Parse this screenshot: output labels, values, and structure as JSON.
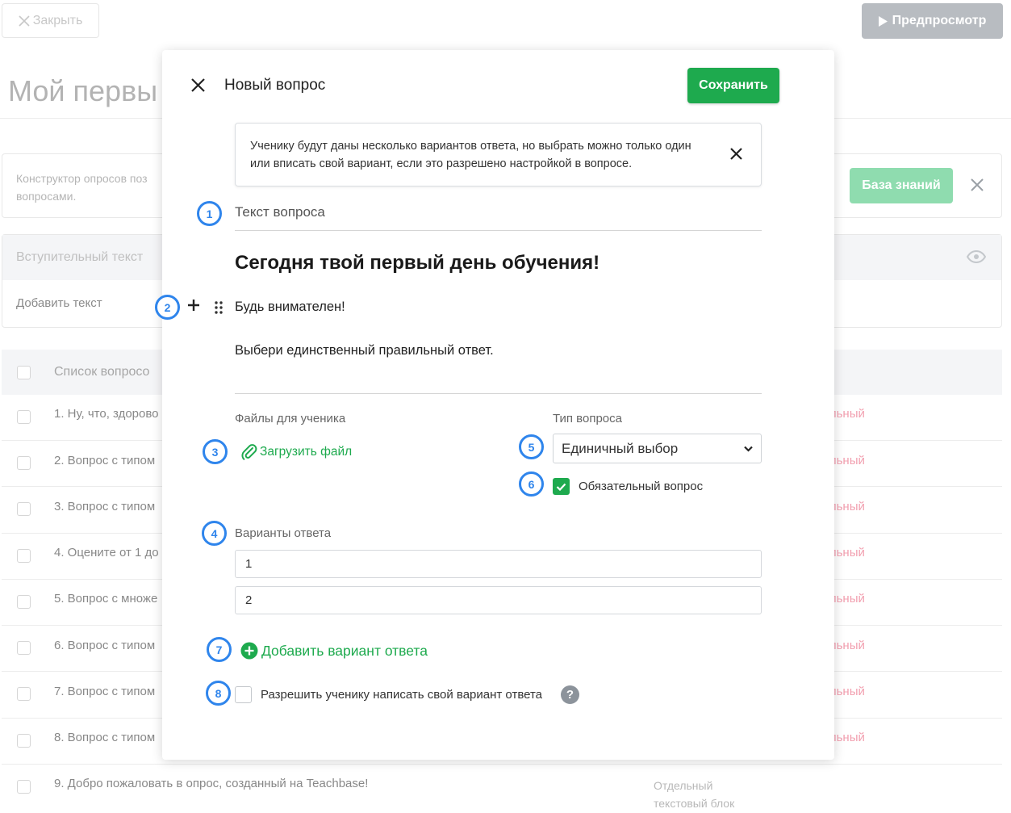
{
  "background": {
    "close_label": "Закрыть",
    "preview_label": "Предпросмотр",
    "page_title": "Мой первы",
    "info_text": "Конструктор опросов поз вопросами.",
    "knowledge_base_label": "База знаний",
    "intro_title": "Вступительный текст",
    "intro_add": "Добавить текст",
    "list_title": "Список вопросо",
    "rows": [
      {
        "text": "1. Ну, что, здорово",
        "type": "ельный"
      },
      {
        "text": "2. Вопрос с типом",
        "type": "ельный"
      },
      {
        "text": "3. Вопрос с типом",
        "type": "ельный"
      },
      {
        "text": "4. Оцените от 1 до",
        "type": "ельный"
      },
      {
        "text": "5. Вопрос с множе",
        "type": "ельный"
      },
      {
        "text": "6. Вопрос с типом",
        "type": "ельный"
      },
      {
        "text": "7. Вопрос с типом",
        "type": "ельный"
      },
      {
        "text": "8. Вопрос с типом",
        "type": "ельный"
      },
      {
        "text": "9. Добро пожаловать в опрос, созданный на Teachbase!",
        "type": "Отдельный текстовый блок"
      }
    ]
  },
  "modal": {
    "title": "Новый вопрос",
    "save_label": "Сохранить",
    "hint": "Ученику будут даны несколько вариантов ответа, но выбрать можно только один или вписать свой вариант, если это разрешено настройкой в вопросе.",
    "question_label": "Текст вопроса",
    "question_heading": "Сегодня твой первый день обучения!",
    "question_p1": "Будь внимателен!",
    "question_p2": "Выбери единственный правильный ответ.",
    "files_label": "Файлы для ученика",
    "upload_label": "Загрузить файл",
    "type_label": "Тип вопроса",
    "type_value": "Единичный выбор",
    "required_label": "Обязательный вопрос",
    "required_checked": true,
    "options_label": "Варианты ответа",
    "options": [
      "1",
      "2"
    ],
    "add_option_label": "Добавить вариант ответа",
    "own_answer_label": "Разрешить ученику написать свой вариант ответа",
    "own_answer_checked": false,
    "help_glyph": "?"
  },
  "annotations": [
    "1",
    "2",
    "3",
    "4",
    "5",
    "6",
    "7",
    "8"
  ],
  "colors": {
    "accent_green": "#1eaa4e",
    "annotation_blue": "#2f85ec",
    "disabled_gray": "#b8bcc1"
  }
}
